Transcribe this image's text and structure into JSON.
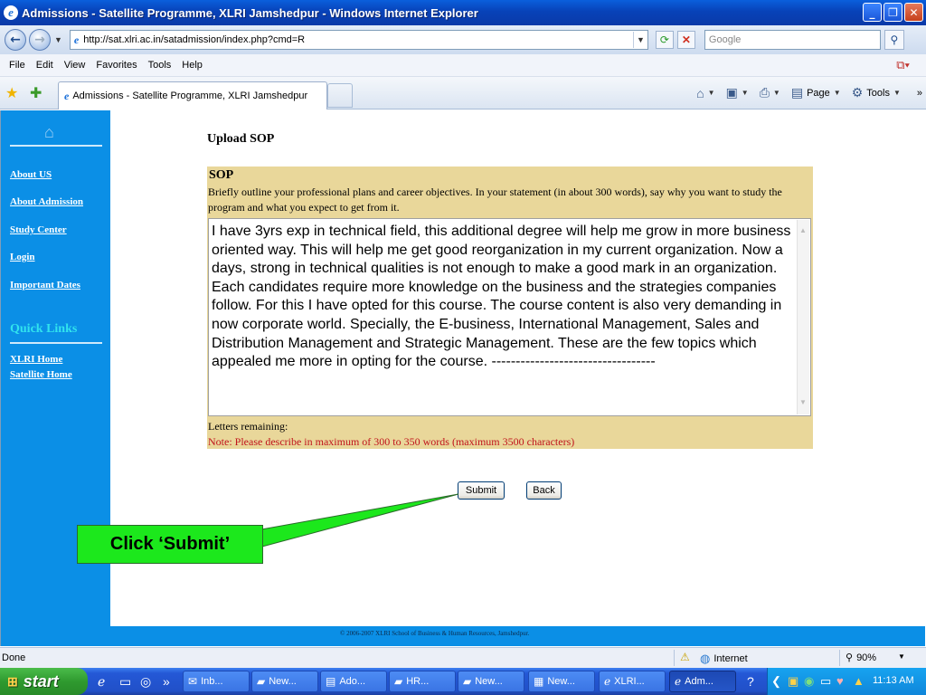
{
  "window": {
    "title": "Admissions - Satellite Programme, XLRI Jamshedpur - Windows Internet Explorer",
    "url": "http://sat.xlri.ac.in/satadmission/index.php?cmd=R",
    "search_placeholder": "Google"
  },
  "menu": [
    "File",
    "Edit",
    "View",
    "Favorites",
    "Tools",
    "Help"
  ],
  "tab": {
    "label": "Admissions - Satellite Programme, XLRI Jamshedpur"
  },
  "commandbar": {
    "page_label": "Page",
    "tools_label": "Tools"
  },
  "sidebar": {
    "links": [
      "About US",
      "About Admission",
      "Study Center",
      "Login",
      "Important Dates"
    ],
    "quick_links_heading": "Quick Links",
    "quick_links": [
      "XLRI Home",
      "Satellite Home"
    ]
  },
  "form": {
    "title": "Upload SOP",
    "section_heading": "SOP",
    "instructions": "Briefly outline your professional plans and career objectives. In your statement (in about 300 words), say why you want to study the program and what you expect to get from it.",
    "sop_text": "I have 3yrs exp in technical field, this additional degree will help me grow in more business oriented way. This will help me get good reorganization in my current organization. Now a days, strong in technical qualities is not enough to make a good mark in an organization. Each candidates require more knowledge on the business and the strategies companies follow. For this I have opted for this course. The course content is also very demanding in now corporate world. Specially, the E-business, International Management, Sales and Distribution Management and Strategic Management. These are the few topics which appealed me more in opting for the course. ----------------------------------",
    "letters_remaining_label": "Letters remaining:",
    "note": "Note: Please describe in maximum of 300 to 350 words (maximum 3500 characters)",
    "submit_label": "Submit",
    "back_label": "Back"
  },
  "callout": {
    "text": "Click ‘Submit’"
  },
  "footer": {
    "copyright": "© 2006-2007 XLRI School of Business & Human Resources, Jamshedpur."
  },
  "statusbar": {
    "status": "Done",
    "zone": "Internet",
    "zoom": "90%"
  },
  "taskbar": {
    "start_label": "start",
    "tasks": [
      "Inb...",
      "New...",
      "Ado...",
      "HR...",
      "New...",
      "New...",
      "XLRI...",
      "Adm..."
    ],
    "clock": "11:13 AM"
  },
  "colors": {
    "sidebar": "#0b8fe6",
    "form_panel": "#e9d79a",
    "note": "#c0141c",
    "callout": "#1ce81c",
    "quick_links": "#31e3ee"
  }
}
